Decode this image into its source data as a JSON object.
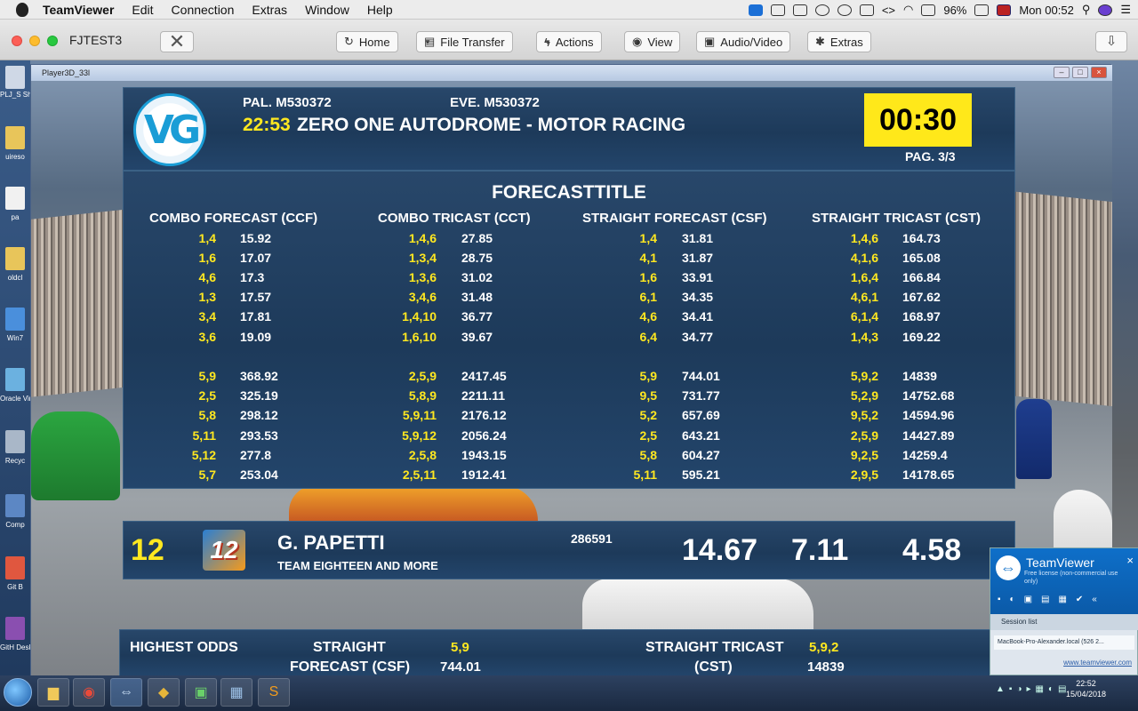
{
  "menubar": {
    "app": "TeamViewer",
    "items": [
      "Edit",
      "Connection",
      "Extras",
      "Window",
      "Help"
    ],
    "battery": "96%",
    "time": "Mon 00:52"
  },
  "toolbar": {
    "title": "FJTEST3",
    "close_label": "✕",
    "buttons": [
      {
        "label": "Home",
        "icon": "home-icon"
      },
      {
        "label": "File Transfer",
        "icon": "file-transfer-icon"
      },
      {
        "label": "Actions",
        "icon": "lightning-icon"
      },
      {
        "label": "View",
        "icon": "eye-icon"
      },
      {
        "label": "Audio/Video",
        "icon": "chat-icon"
      },
      {
        "label": "Extras",
        "icon": "gear-icon"
      }
    ]
  },
  "remote_window": {
    "title": "Player3D_33l"
  },
  "desktop_icons": [
    "PLJ_S Shor",
    "uireso",
    "pa",
    "oldcl",
    "Win7",
    "Oracle Virtu",
    "Recyc",
    "Comp",
    "Git B",
    "GitH Desk"
  ],
  "header": {
    "pal": "PAL. M530372",
    "eve": "EVE. M530372",
    "race_time": "22:53",
    "race_name": "ZERO ONE AUTODROME - MOTOR RACING",
    "countdown": "00:30",
    "page": "PAG. 3/3",
    "logo_text": "VG"
  },
  "forecast": {
    "title": "FORECASTTITLE",
    "columns": [
      {
        "heading": "COMBO FORECAST (CCF)",
        "rows": [
          {
            "combo": "1,4",
            "odds": "15.92"
          },
          {
            "combo": "1,6",
            "odds": "17.07"
          },
          {
            "combo": "4,6",
            "odds": "17.3"
          },
          {
            "combo": "1,3",
            "odds": "17.57"
          },
          {
            "combo": "3,4",
            "odds": "17.81"
          },
          {
            "combo": "3,6",
            "odds": "19.09"
          },
          {
            "combo": "5,9",
            "odds": "368.92"
          },
          {
            "combo": "2,5",
            "odds": "325.19"
          },
          {
            "combo": "5,8",
            "odds": "298.12"
          },
          {
            "combo": "5,11",
            "odds": "293.53"
          },
          {
            "combo": "5,12",
            "odds": "277.8"
          },
          {
            "combo": "5,7",
            "odds": "253.04"
          }
        ]
      },
      {
        "heading": "COMBO TRICAST (CCT)",
        "rows": [
          {
            "combo": "1,4,6",
            "odds": "27.85"
          },
          {
            "combo": "1,3,4",
            "odds": "28.75"
          },
          {
            "combo": "1,3,6",
            "odds": "31.02"
          },
          {
            "combo": "3,4,6",
            "odds": "31.48"
          },
          {
            "combo": "1,4,10",
            "odds": "36.77"
          },
          {
            "combo": "1,6,10",
            "odds": "39.67"
          },
          {
            "combo": "2,5,9",
            "odds": "2417.45"
          },
          {
            "combo": "5,8,9",
            "odds": "2211.11"
          },
          {
            "combo": "5,9,11",
            "odds": "2176.12"
          },
          {
            "combo": "5,9,12",
            "odds": "2056.24"
          },
          {
            "combo": "2,5,8",
            "odds": "1943.15"
          },
          {
            "combo": "2,5,11",
            "odds": "1912.41"
          }
        ]
      },
      {
        "heading": "STRAIGHT FORECAST (CSF)",
        "rows": [
          {
            "combo": "1,4",
            "odds": "31.81"
          },
          {
            "combo": "4,1",
            "odds": "31.87"
          },
          {
            "combo": "1,6",
            "odds": "33.91"
          },
          {
            "combo": "6,1",
            "odds": "34.35"
          },
          {
            "combo": "4,6",
            "odds": "34.41"
          },
          {
            "combo": "6,4",
            "odds": "34.77"
          },
          {
            "combo": "5,9",
            "odds": "744.01"
          },
          {
            "combo": "9,5",
            "odds": "731.77"
          },
          {
            "combo": "5,2",
            "odds": "657.69"
          },
          {
            "combo": "2,5",
            "odds": "643.21"
          },
          {
            "combo": "5,8",
            "odds": "604.27"
          },
          {
            "combo": "5,11",
            "odds": "595.21"
          }
        ]
      },
      {
        "heading": "STRAIGHT TRICAST (CST)",
        "rows": [
          {
            "combo": "1,4,6",
            "odds": "164.73"
          },
          {
            "combo": "4,1,6",
            "odds": "165.08"
          },
          {
            "combo": "1,6,4",
            "odds": "166.84"
          },
          {
            "combo": "4,6,1",
            "odds": "167.62"
          },
          {
            "combo": "6,1,4",
            "odds": "168.97"
          },
          {
            "combo": "1,4,3",
            "odds": "169.22"
          },
          {
            "combo": "5,9,2",
            "odds": "14839"
          },
          {
            "combo": "5,2,9",
            "odds": "14752.68"
          },
          {
            "combo": "9,5,2",
            "odds": "14594.96"
          },
          {
            "combo": "2,5,9",
            "odds": "14427.89"
          },
          {
            "combo": "9,2,5",
            "odds": "14259.4"
          },
          {
            "combo": "2,9,5",
            "odds": "14178.65"
          }
        ]
      }
    ]
  },
  "driver": {
    "number": "12",
    "badge": "12",
    "name": "G. PAPETTI",
    "team": "TEAM EIGHTEEN AND MORE",
    "id": "286591",
    "odds": [
      "14.67",
      "7.11",
      "4.58"
    ]
  },
  "highest_odds": {
    "label": "HIGHEST ODDS",
    "sf_line1": "STRAIGHT",
    "sf_line2": "FORECAST (CSF)",
    "sf_combo": "5,9",
    "sf_odds": "744.01",
    "st_line1": "STRAIGHT TRICAST",
    "st_line2": "(CST)",
    "st_combo": "5,9,2",
    "st_odds": "14839"
  },
  "teamviewer_popup": {
    "brand": "TeamViewer",
    "license": "Free license (non-commercial use only)",
    "session_list": "Session list",
    "session_item": "MacBook-Pro-Alexander.local (526 2...",
    "website": "www.teamviewer.com"
  },
  "taskbar": {
    "time": "22:52",
    "date": "15/04/2018"
  }
}
